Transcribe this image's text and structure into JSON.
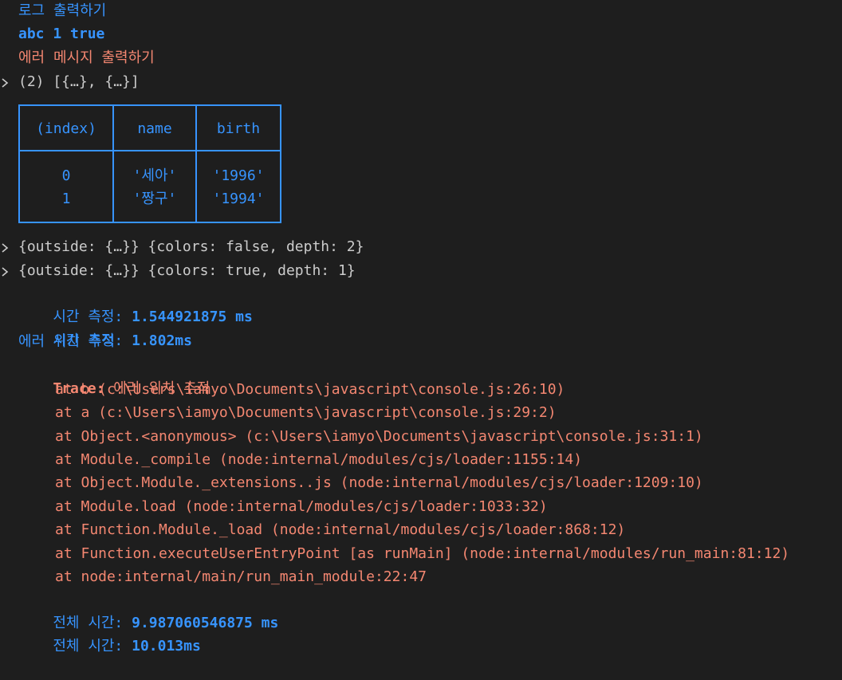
{
  "console": {
    "log1": "로그 출력하기",
    "log2": "abc 1 true",
    "err1": "에러 메시지 출력하기",
    "arr": "(2) [{…}, {…}]",
    "table": {
      "headers": [
        "(index)",
        "name",
        "birth"
      ],
      "rows": [
        [
          "0",
          "'세아'",
          "'1996'"
        ],
        [
          "1",
          "'짱구'",
          "'1994'"
        ]
      ]
    },
    "dir1": "{outside: {…}} {colors: false, depth: 2}",
    "dir2": "{outside: {…}} {colors: true, depth: 1}",
    "time1_label": "시간 측정:",
    "time1_value": "1.544921875 ms",
    "time2_label": "시간 측정:",
    "time2_value": "1.802ms",
    "trace_title": "에러 위치 추적",
    "trace_label": "Trace:",
    "trace_msg": "에러 위치 추적",
    "stack": [
      "at b (c:\\Users\\iamyo\\Documents\\javascript\\console.js:26:10)",
      "at a (c:\\Users\\iamyo\\Documents\\javascript\\console.js:29:2)",
      "at Object.<anonymous> (c:\\Users\\iamyo\\Documents\\javascript\\console.js:31:1)",
      "at Module._compile (node:internal/modules/cjs/loader:1155:14)",
      "at Object.Module._extensions..js (node:internal/modules/cjs/loader:1209:10)",
      "at Module.load (node:internal/modules/cjs/loader:1033:32)",
      "at Function.Module._load (node:internal/modules/cjs/loader:868:12)",
      "at Function.executeUserEntryPoint [as runMain] (node:internal/modules/run_main:81:12)",
      "at node:internal/main/run_main_module:22:47"
    ],
    "total1_label": "전체 시간:",
    "total1_value": "9.987060546875 ms",
    "total2_label": "전체 시간:",
    "total2_value": "10.013ms"
  },
  "colors": {
    "background": "#1e1e1e",
    "info": "#3794ff",
    "error": "#f48771",
    "text": "#cccccc"
  },
  "icons": {
    "expand": "chevron-right-icon"
  }
}
